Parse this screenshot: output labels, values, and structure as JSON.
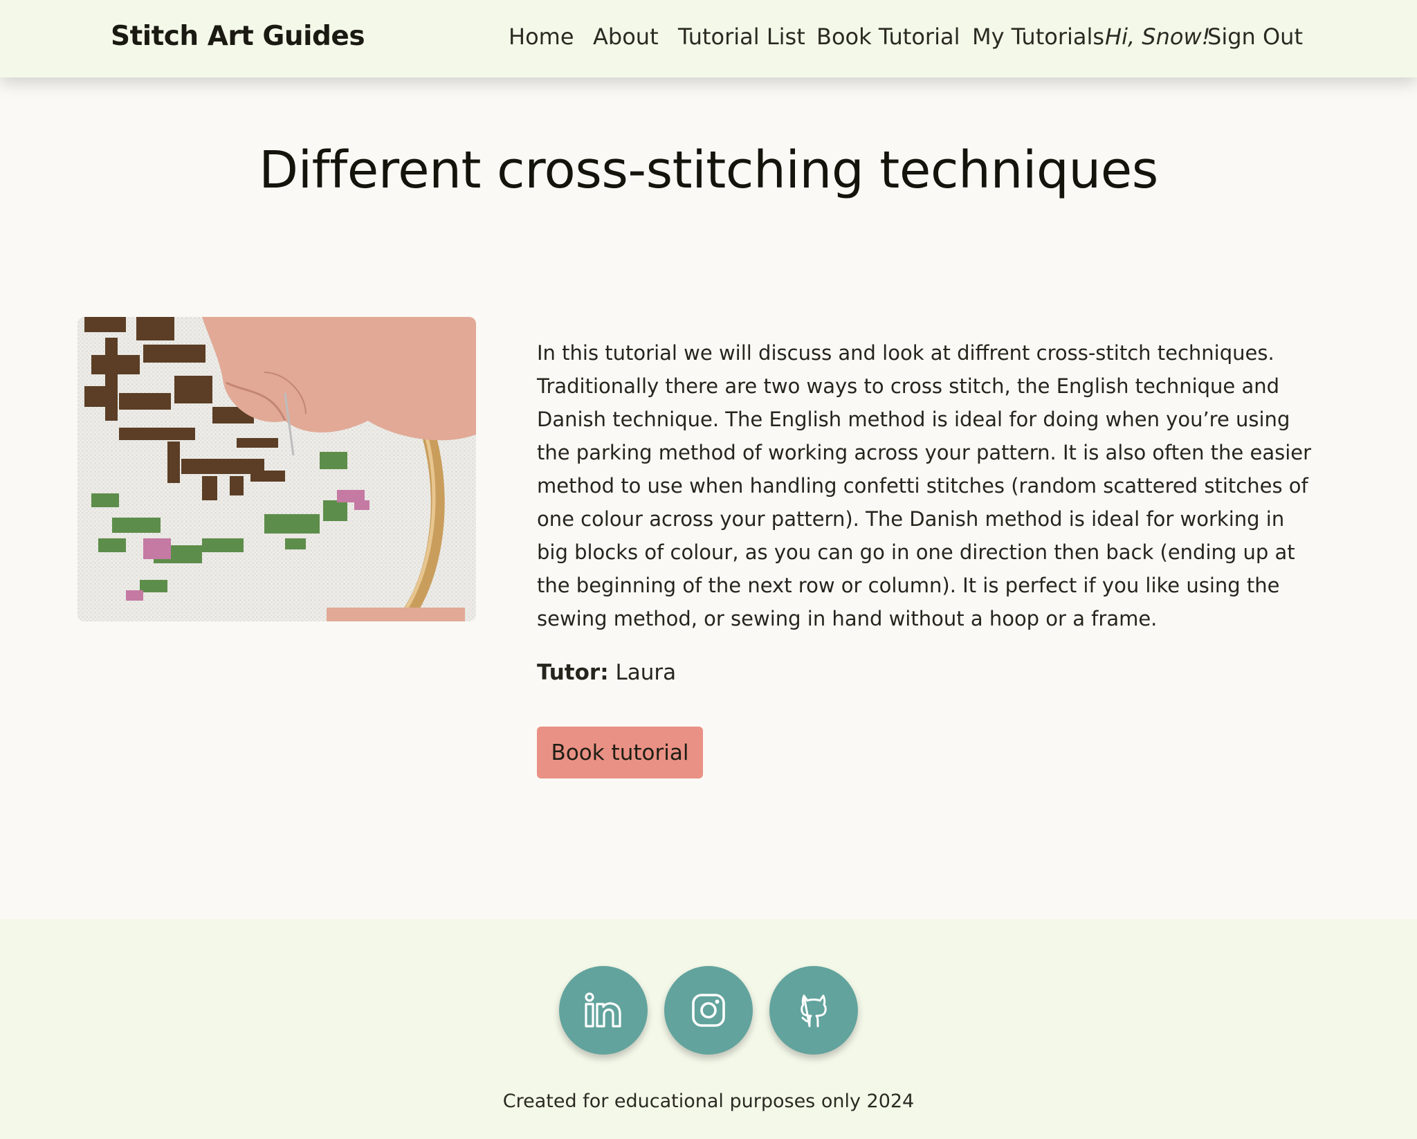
{
  "navbar": {
    "brand": "Stitch Art Guides",
    "links": [
      "Home",
      "About",
      "Tutorial List",
      "Book Tutorial",
      "My Tutorials"
    ],
    "greeting": "Hi, Snow!",
    "sign_out": "Sign Out"
  },
  "page": {
    "title": "Different cross-stitching techniques"
  },
  "tutorial": {
    "image_icon": "cross-stitch-hoop-photo",
    "description": "In this tutorial we will discuss and look at diffrent cross-stitch techniques. Traditionally there are two ways to cross stitch, the English technique and Danish technique. The English method is ideal for doing when you’re using the parking method of working across your pattern. It is also often the easier method to use when handling confetti stitches (random scattered stitches of one colour across your pattern). The Danish method is ideal for working in big blocks of colour, as you can go in one direction then back (ending up at the beginning of the next row or column). It is perfect if you like using the sewing method, or sewing in hand without a hoop or a frame.",
    "tutor_label": "Tutor:",
    "tutor_name": "Laura",
    "book_button": "Book tutorial"
  },
  "footer": {
    "social_icons": [
      "linkedin-icon",
      "instagram-icon",
      "github-icon"
    ],
    "icon_color": "#62a39d",
    "note": "Created for educational purposes only 2024"
  },
  "colors": {
    "navbar_bg": "#f4f8e9",
    "page_bg": "#faf9f5",
    "button_bg": "#ea9185"
  }
}
